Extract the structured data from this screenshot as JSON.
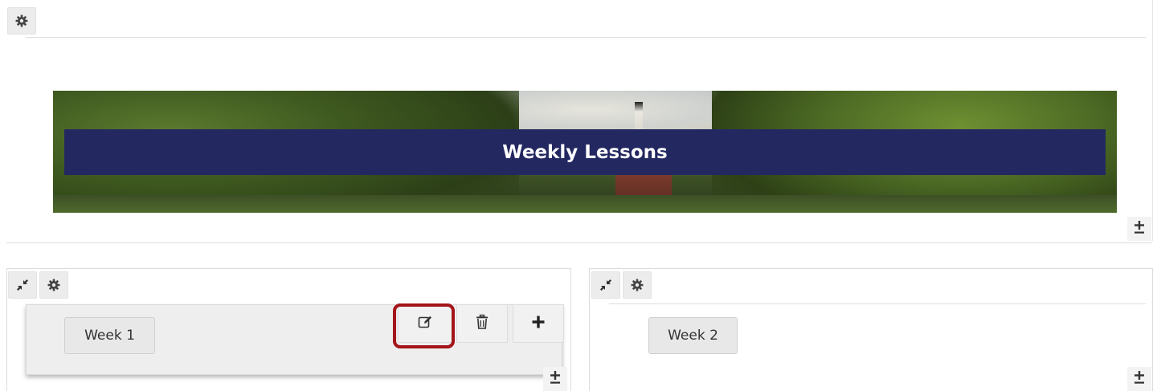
{
  "section_top": {
    "settings_icon": "gear-icon"
  },
  "banner": {
    "title": "Weekly Lessons",
    "add_below_icon": "plus-minus-icon"
  },
  "column_left": {
    "collapse_icon": "collapse-arrows-icon",
    "settings_icon": "gear-icon",
    "item_label": "Week 1",
    "tools": {
      "edit_icon": "edit-icon",
      "delete_icon": "trash-icon",
      "add_icon": "plus-icon"
    },
    "add_below_icon": "plus-minus-icon",
    "highlight_color": "#a3151a"
  },
  "column_right": {
    "collapse_icon": "collapse-arrows-icon",
    "settings_icon": "gear-icon",
    "item_label": "Week 2",
    "add_below_icon": "plus-minus-icon"
  },
  "colors": {
    "banner_title_bg": "#232861",
    "button_bg": "#ececec"
  }
}
